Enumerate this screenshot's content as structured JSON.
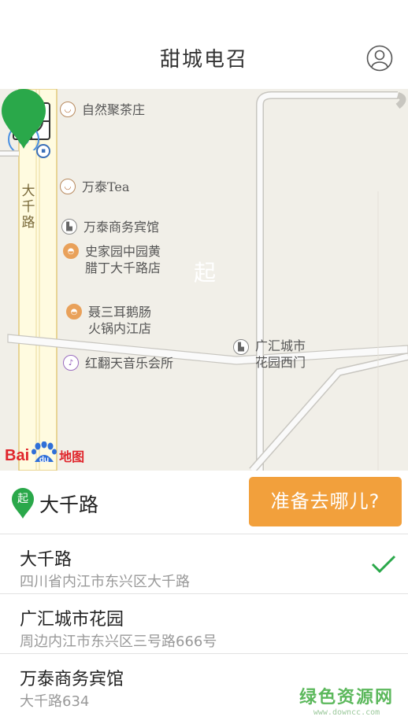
{
  "header": {
    "title": "甜城电召",
    "user_icon": "user-icon"
  },
  "map": {
    "road_label": "大千路",
    "pois": [
      {
        "name": "自然聚茶庄",
        "icon": "tea-icon"
      },
      {
        "name": "万泰Tea",
        "icon": "tea-icon"
      },
      {
        "name": "万泰商务宾馆",
        "icon": "hotel-icon"
      },
      {
        "name": "史家园中园黄\n腊丁大千路店",
        "icon": "restaurant-icon"
      },
      {
        "name": "聂三耳鹅肠\n火锅内江店",
        "icon": "restaurant-icon"
      },
      {
        "name": "红翻天音乐会所",
        "icon": "music-icon"
      },
      {
        "name": "广汇城市\n花园西门",
        "icon": "hotel-icon"
      }
    ],
    "start_marker": "起",
    "logo": {
      "part1": "Bai",
      "part2": "du",
      "part3": "地图"
    }
  },
  "start_bar": {
    "marker": "起",
    "location": "大千路",
    "go_button": "准备去哪儿?"
  },
  "results": [
    {
      "name": "大千路",
      "address": "四川省内江市东兴区大千路",
      "selected": true
    },
    {
      "name": "广汇城市花园",
      "address": "周边内江市东兴区三号路666号",
      "selected": false
    },
    {
      "name": "万泰商务宾馆",
      "address": "大千路634",
      "selected": false
    }
  ],
  "watermark": {
    "line1": "绿色资源网",
    "line2": "www.downcc.com"
  },
  "colors": {
    "accent_orange": "#f2a03c",
    "pin_green": "#2aa84a",
    "check_green": "#2aa84a"
  }
}
